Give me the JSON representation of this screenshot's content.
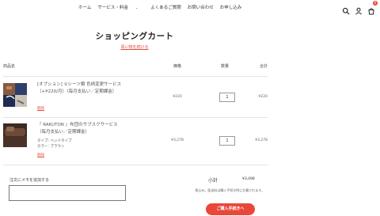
{
  "nav": {
    "links": [
      "ホーム",
      "サービス・料金",
      "よくあるご質問",
      "お問い合わせ",
      "お申し込み"
    ],
    "cart_count": "0"
  },
  "page": {
    "title": "ショッピングカート",
    "continue_link": "買い物を続ける"
  },
  "table": {
    "headers": {
      "product": "商品名",
      "price": "価格",
      "qty": "数量",
      "total": "合計"
    },
    "rows": [
      {
        "name": "[オプション] ①シーツ類 色柄変更サービス（+¥220/月）（毎月支払い／定期課金）",
        "options": [],
        "remove": "削除",
        "price": "¥220",
        "qty": "1",
        "total": "¥220"
      },
      {
        "name": "『 RAKUTON 』布団のサブスクサービス（毎月支払い／定期課金）",
        "options": [
          "タイプ: ベッドタイプ",
          "カラー: ブラウン"
        ],
        "remove": "削除",
        "price": "¥3,278",
        "qty": "1",
        "total": "¥3,278"
      }
    ]
  },
  "note": {
    "label": "注文にメモを追加する",
    "value": ""
  },
  "summary": {
    "subtotal_label": "小計",
    "subtotal_value": "¥3,498",
    "tax_note": "税込み。配送料は購入手続き時に計算されます。",
    "checkout_label": "ご購入手続きへ"
  },
  "colors": {
    "accent": "#e8473a"
  }
}
